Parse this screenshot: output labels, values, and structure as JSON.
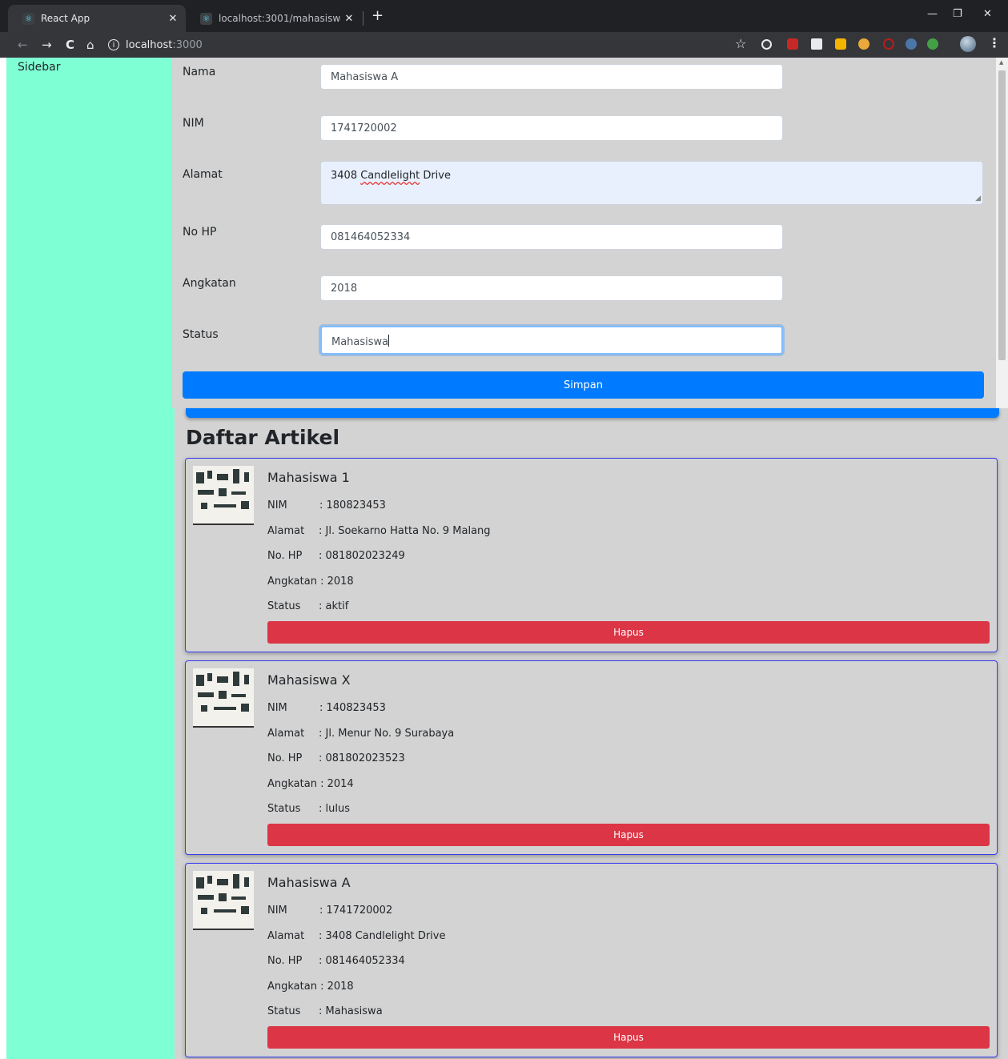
{
  "browser": {
    "tabs": [
      {
        "title": "React App",
        "active": true
      },
      {
        "title": "localhost:3001/mahasiswa",
        "active": false
      }
    ],
    "new_tab_icon": "+",
    "url_host": "localhost",
    "url_port": ":3000"
  },
  "sidebar": {
    "label": "Sidebar"
  },
  "form": {
    "fields": {
      "nama": {
        "label": "Nama",
        "value": "Mahasiswa A"
      },
      "nim": {
        "label": "NIM",
        "value": "1741720002"
      },
      "alamat": {
        "label": "Alamat",
        "value_plain": "3408 ",
        "value_misspelled": "Candlelight",
        "value_rest": " Drive"
      },
      "no_hp": {
        "label": "No HP",
        "value": "081464052334"
      },
      "angkatan": {
        "label": "Angkatan",
        "value": "2018"
      },
      "status": {
        "label": "Status",
        "value": "Mahasiswa"
      }
    },
    "submit_label": "Simpan"
  },
  "list": {
    "title": "Daftar Artikel",
    "labels": {
      "nim": "NIM",
      "alamat": "Alamat",
      "no_hp": "No. HP",
      "angkatan": "Angkatan",
      "status": "Status"
    },
    "delete_label": "Hapus",
    "items": [
      {
        "nama": "Mahasiswa 1",
        "nim": ": 180823453",
        "alamat": ": Jl. Soekarno Hatta No. 9 Malang",
        "no_hp": ": 081802023249",
        "angkatan": ": 2018",
        "status": ": aktif"
      },
      {
        "nama": "Mahasiswa X",
        "nim": ": 140823453",
        "alamat": ": Jl. Menur No. 9 Surabaya",
        "no_hp": ": 081802023523",
        "angkatan": ": 2014",
        "status": ": lulus"
      },
      {
        "nama": "Mahasiswa A",
        "nim": ": 1741720002",
        "alamat": ": 3408 Candlelight Drive",
        "no_hp": ": 081464052334",
        "angkatan": ": 2018",
        "status": ": Mahasiswa"
      }
    ]
  },
  "colors": {
    "sidebar_bg": "#7fffd4",
    "content_bg": "#d3d3d3",
    "primary": "#007bff",
    "danger": "#dc3545",
    "card_border": "#3a3af0"
  }
}
